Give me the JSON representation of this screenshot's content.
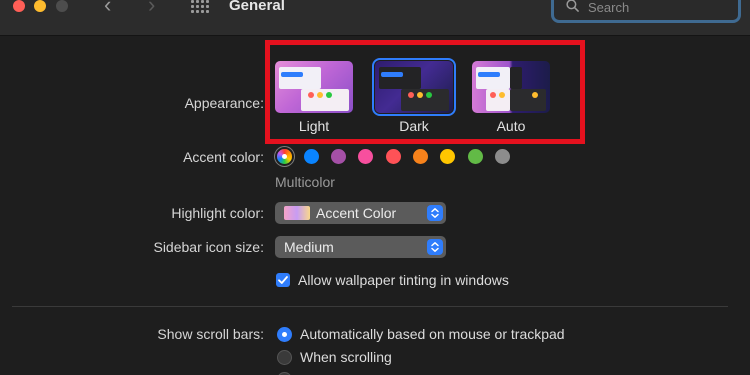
{
  "window": {
    "title": "General",
    "traffic_lights": {
      "close": "#ff5f57",
      "minimize": "#febc2e",
      "zoom": "#4d4d4d"
    }
  },
  "toolbar": {
    "back_icon": "‹",
    "forward_icon": "›",
    "grid_icon": "grid-icon",
    "search_placeholder": "Search"
  },
  "appearance": {
    "label": "Appearance:",
    "options": [
      {
        "label": "Light",
        "selected": false
      },
      {
        "label": "Dark",
        "selected": true
      },
      {
        "label": "Auto",
        "selected": false
      }
    ]
  },
  "accent": {
    "label": "Accent color:",
    "selected_name": "Multicolor",
    "colors": [
      "multicolor",
      "#0a84ff",
      "#a550a7",
      "#f74f9e",
      "#ff5257",
      "#f7821b",
      "#ffc600",
      "#62ba46",
      "#8c8c8c"
    ]
  },
  "highlight": {
    "label": "Highlight color:",
    "value": "Accent Color"
  },
  "sidebar_icon": {
    "label": "Sidebar icon size:",
    "value": "Medium"
  },
  "wallpaper_tinting": {
    "label": "Allow wallpaper tinting in windows",
    "checked": true
  },
  "scroll_bars": {
    "label": "Show scroll bars:",
    "options": [
      {
        "label": "Automatically based on mouse or trackpad",
        "selected": true
      },
      {
        "label": "When scrolling",
        "selected": false
      }
    ]
  },
  "colors": {
    "accent": "#2f7dfc",
    "annotation": "#e5111e"
  }
}
